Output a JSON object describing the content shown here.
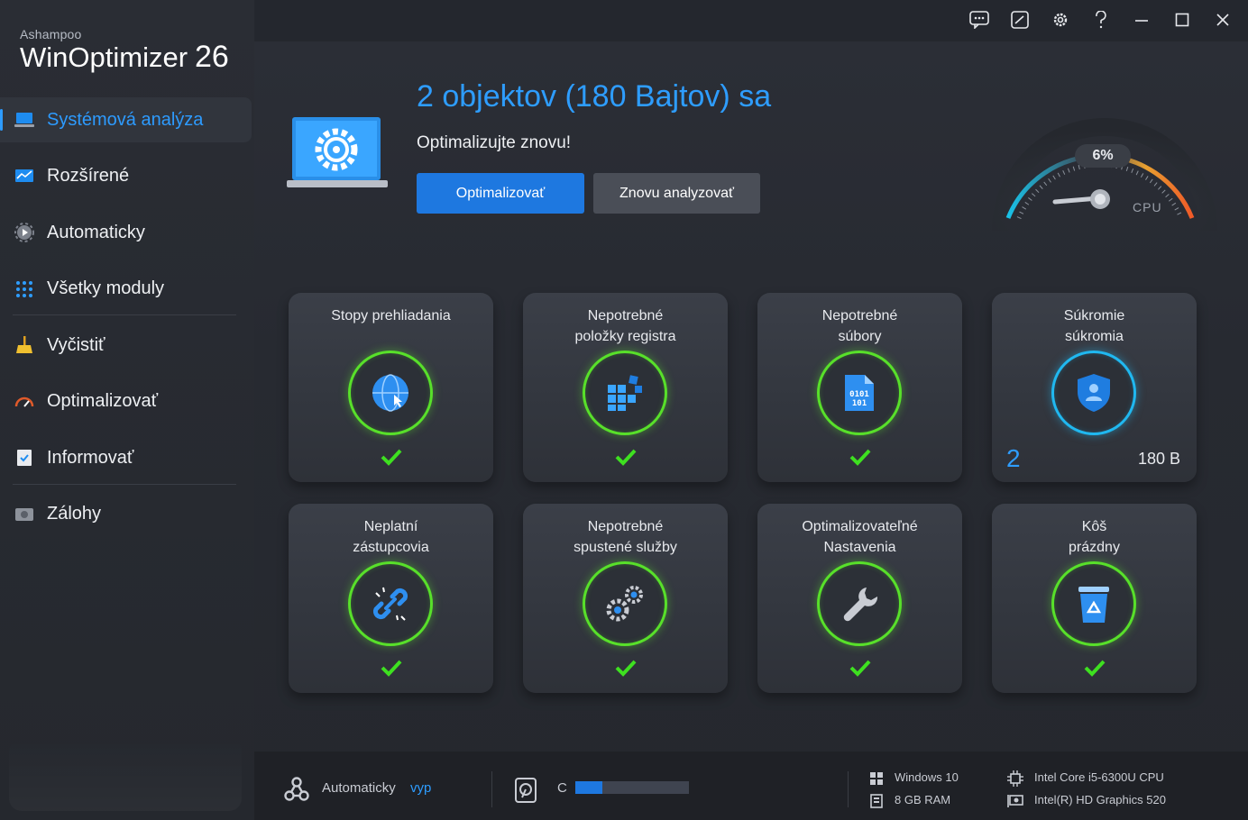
{
  "app": {
    "brand_small": "Ashampoo",
    "brand_name": "WinOptimizer",
    "brand_version": "26"
  },
  "titlebar": {
    "icons": [
      "feedback-icon",
      "edit-icon",
      "gear-icon",
      "help-icon",
      "minimize-icon",
      "maximize-icon",
      "close-icon"
    ]
  },
  "sidebar": {
    "items": [
      {
        "label": "Systémová analýza",
        "icon": "laptop-icon",
        "active": true
      },
      {
        "label": "Rozšírené",
        "icon": "monitor-chart-icon"
      },
      {
        "label": "Automaticky",
        "icon": "auto-gear-icon"
      },
      {
        "label": "Všetky moduly",
        "icon": "grid-icon"
      },
      {
        "label": "Vyčistiť",
        "icon": "broom-icon"
      },
      {
        "label": "Optimalizovať",
        "icon": "speedometer-icon"
      },
      {
        "label": "Informovať",
        "icon": "checklist-icon"
      },
      {
        "label": "Zálohy",
        "icon": "backup-drive-icon"
      }
    ]
  },
  "hero": {
    "headline": "2 objektov (180 Bajtov) sa",
    "subline": "Optimalizujte znovu!",
    "primary_button": "Optimalizovať",
    "secondary_button": "Znovu analyzovať"
  },
  "gauge": {
    "value_text": "6%",
    "value": 6,
    "label": "CPU"
  },
  "tiles": [
    {
      "title": "Stopy prehliadania",
      "icon": "globe-icon",
      "status": "ok"
    },
    {
      "title": "Nepotrebné\npoložky registra",
      "icon": "registry-blocks-icon",
      "status": "ok"
    },
    {
      "title": "Nepotrebné\nsúbory",
      "icon": "binary-file-icon",
      "status": "ok"
    },
    {
      "title": "Súkromie\nsúkromia",
      "icon": "shield-user-icon",
      "status": "found",
      "count": "2",
      "size": "180 B"
    },
    {
      "title": "Neplatní\nzástupcovia",
      "icon": "broken-link-icon",
      "status": "ok"
    },
    {
      "title": "Nepotrebné\nspustené služby",
      "icon": "gears-icon",
      "status": "ok"
    },
    {
      "title": "Optimalizovateľné\nNastavenia",
      "icon": "wrench-icon",
      "status": "ok"
    },
    {
      "title": "Kôš\nprázdny",
      "icon": "recycle-bin-icon",
      "status": "ok"
    }
  ],
  "statusbar": {
    "auto_label": "Automaticky",
    "auto_state": "vyp",
    "drive_label": "C",
    "drive_fill": 0.24,
    "os": "Windows 10",
    "ram": "8 GB RAM",
    "cpu": "Intel Core i5-6300U CPU",
    "gpu": "Intel(R) HD Graphics 520"
  },
  "colors": {
    "accent": "#2e9dff",
    "ok_green": "#58e02a",
    "button_primary": "#1e78e0"
  }
}
